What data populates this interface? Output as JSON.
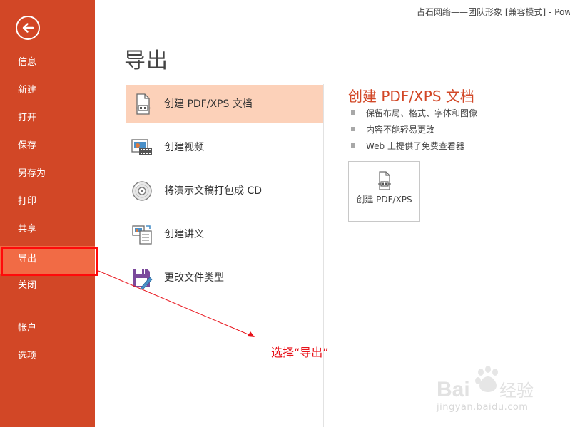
{
  "window": {
    "title": "占石网络——团队形象 [兼容模式] - PowerPoint"
  },
  "sidebar": {
    "back_label": "返回",
    "items": [
      {
        "label": "信息"
      },
      {
        "label": "新建"
      },
      {
        "label": "打开"
      },
      {
        "label": "保存"
      },
      {
        "label": "另存为"
      },
      {
        "label": "打印"
      },
      {
        "label": "共享"
      },
      {
        "label": "导出",
        "active": true
      },
      {
        "label": "关闭"
      },
      {
        "label": "帐户"
      },
      {
        "label": "选项"
      }
    ]
  },
  "main": {
    "title": "导出",
    "options": [
      {
        "label": "创建 PDF/XPS 文档",
        "icon": "pdf-document-icon",
        "selected": true
      },
      {
        "label": "创建视频",
        "icon": "video-icon"
      },
      {
        "label": "将演示文稿打包成 CD",
        "icon": "cd-icon"
      },
      {
        "label": "创建讲义",
        "icon": "handout-icon"
      },
      {
        "label": "更改文件类型",
        "icon": "save-file-type-icon"
      }
    ]
  },
  "detail": {
    "title": "创建 PDF/XPS 文档",
    "bullets": [
      "保留布局、格式、字体和图像",
      "内容不能轻易更改",
      "Web 上提供了免费查看器"
    ],
    "button_label": "创建 PDF/XPS",
    "button_icon": "pdf-document-icon"
  },
  "annotation": {
    "text": "选择“导出”",
    "color": "#e8121a"
  },
  "watermark": {
    "text": "Baidu 经验",
    "url": "jingyan.baidu.com"
  },
  "colors": {
    "accent": "#d24726",
    "sidebar_active": "#f16b45",
    "selected_option": "#fcd1b9",
    "annotation": "#e8121a"
  }
}
